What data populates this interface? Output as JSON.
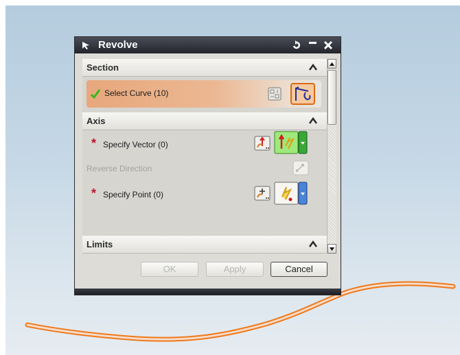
{
  "window": {
    "title": "Revolve"
  },
  "groups": {
    "section": {
      "title": "Section",
      "select_curve_label": "Select Curve (10)"
    },
    "axis": {
      "title": "Axis",
      "specify_vector_label": "Specify Vector (0)",
      "reverse_direction_label": "Reverse Direction",
      "specify_point_label": "Specify Point (0)"
    },
    "limits": {
      "title": "Limits"
    }
  },
  "footer": {
    "ok_label": "OK",
    "apply_label": "Apply",
    "cancel_label": "Cancel"
  },
  "icons": {
    "title_arrow": "cursor-arrow-icon",
    "reset": "reset-icon",
    "minimize": "minimize-icon",
    "close": "close-icon",
    "section_check": "green-check-icon",
    "curve_rule": "curve-rule-icon",
    "select_curve": "select-curve-icon",
    "vector_dialog": "vector-dialog-icon",
    "vector_inferred": "inferred-vector-icon",
    "reverse_direction": "reverse-direction-icon",
    "point_dialog": "point-dialog-icon",
    "point_inferred": "inferred-point-icon"
  },
  "colors": {
    "selected_row": "#e8a77c",
    "required_asterisk": "#c4122a",
    "check_green": "#38b81e",
    "curve_orange": "#f07818",
    "titlebar": "#2c2e36"
  }
}
